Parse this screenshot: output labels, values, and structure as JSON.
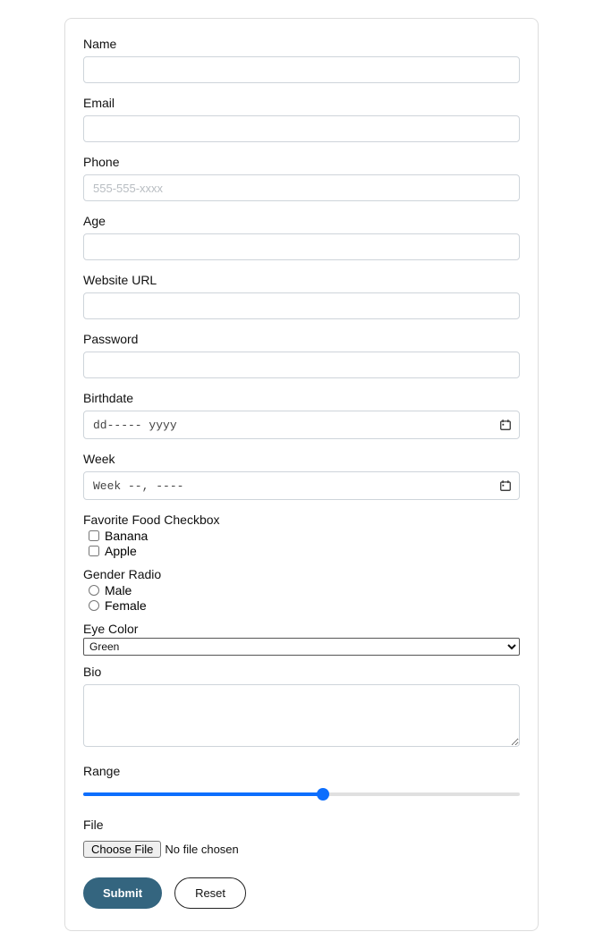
{
  "fields": {
    "name": {
      "label": "Name",
      "value": "",
      "placeholder": ""
    },
    "email": {
      "label": "Email",
      "value": "",
      "placeholder": ""
    },
    "phone": {
      "label": "Phone",
      "value": "",
      "placeholder": "555-555-xxxx"
    },
    "age": {
      "label": "Age",
      "value": "",
      "placeholder": ""
    },
    "website": {
      "label": "Website URL",
      "value": "",
      "placeholder": ""
    },
    "password": {
      "label": "Password",
      "value": "",
      "placeholder": ""
    },
    "birthdate": {
      "label": "Birthdate",
      "displayValue": "dd----- yyyy"
    },
    "week": {
      "label": "Week",
      "displayValue": "Week --, ----"
    },
    "favoriteFood": {
      "label": "Favorite Food Checkbox",
      "options": [
        {
          "label": "Banana",
          "checked": false
        },
        {
          "label": "Apple",
          "checked": false
        }
      ]
    },
    "gender": {
      "label": "Gender Radio",
      "options": [
        {
          "label": "Male",
          "checked": false
        },
        {
          "label": "Female",
          "checked": false
        }
      ]
    },
    "eyeColor": {
      "label": "Eye Color",
      "selected": "Green",
      "options": [
        "Green"
      ]
    },
    "bio": {
      "label": "Bio",
      "value": ""
    },
    "range": {
      "label": "Range",
      "value": 55,
      "min": 0,
      "max": 100
    },
    "file": {
      "label": "File",
      "buttonLabel": "Choose File",
      "status": "No file chosen"
    }
  },
  "actions": {
    "submit": "Submit",
    "reset": "Reset"
  },
  "colors": {
    "accent": "#0d6efd",
    "submitBg": "#34657f"
  }
}
